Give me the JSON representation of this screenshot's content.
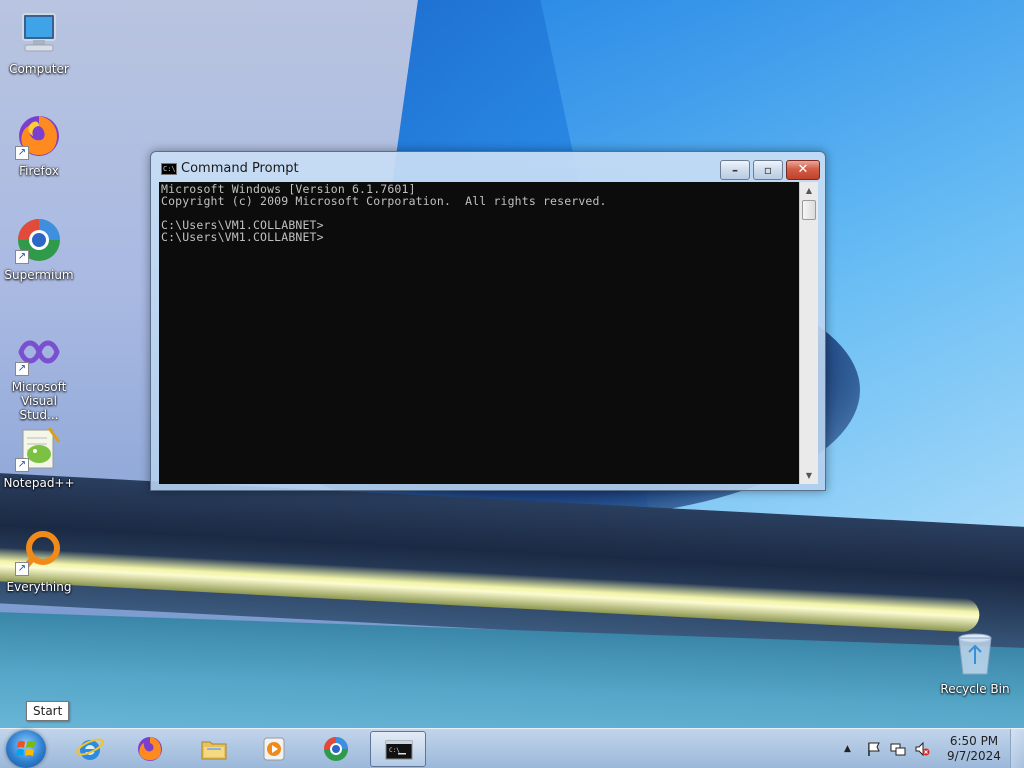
{
  "desktop": {
    "icons": [
      {
        "label": "Computer",
        "icon": "computer-icon"
      },
      {
        "label": "Firefox",
        "icon": "firefox-icon"
      },
      {
        "label": "Supermium",
        "icon": "supermium-icon"
      },
      {
        "label": "Microsoft Visual Stud...",
        "icon": "visual-studio-icon"
      },
      {
        "label": "Notepad++",
        "icon": "notepadpp-icon"
      },
      {
        "label": "Everything",
        "icon": "everything-icon"
      },
      {
        "label": "Recycle Bin",
        "icon": "recycle-bin-icon"
      }
    ]
  },
  "window": {
    "title": "Command Prompt",
    "console_text": "Microsoft Windows [Version 6.1.7601]\nCopyright (c) 2009 Microsoft Corporation.  All rights reserved.\n\nC:\\Users\\VM1.COLLABNET>\nC:\\Users\\VM1.COLLABNET>",
    "minimize": "–",
    "maximize": "▫",
    "close": "✕"
  },
  "tooltip": {
    "text": "Start"
  },
  "taskbar": {
    "items": [
      {
        "name": "internet-explorer",
        "icon": "ie-icon"
      },
      {
        "name": "firefox",
        "icon": "firefox-icon"
      },
      {
        "name": "file-explorer",
        "icon": "folder-icon"
      },
      {
        "name": "media-player",
        "icon": "media-player-icon"
      },
      {
        "name": "supermium",
        "icon": "supermium-icon"
      },
      {
        "name": "command-prompt",
        "icon": "cmd-icon",
        "active": true
      }
    ],
    "clock": {
      "time": "6:50 PM",
      "date": "9/7/2024"
    }
  }
}
